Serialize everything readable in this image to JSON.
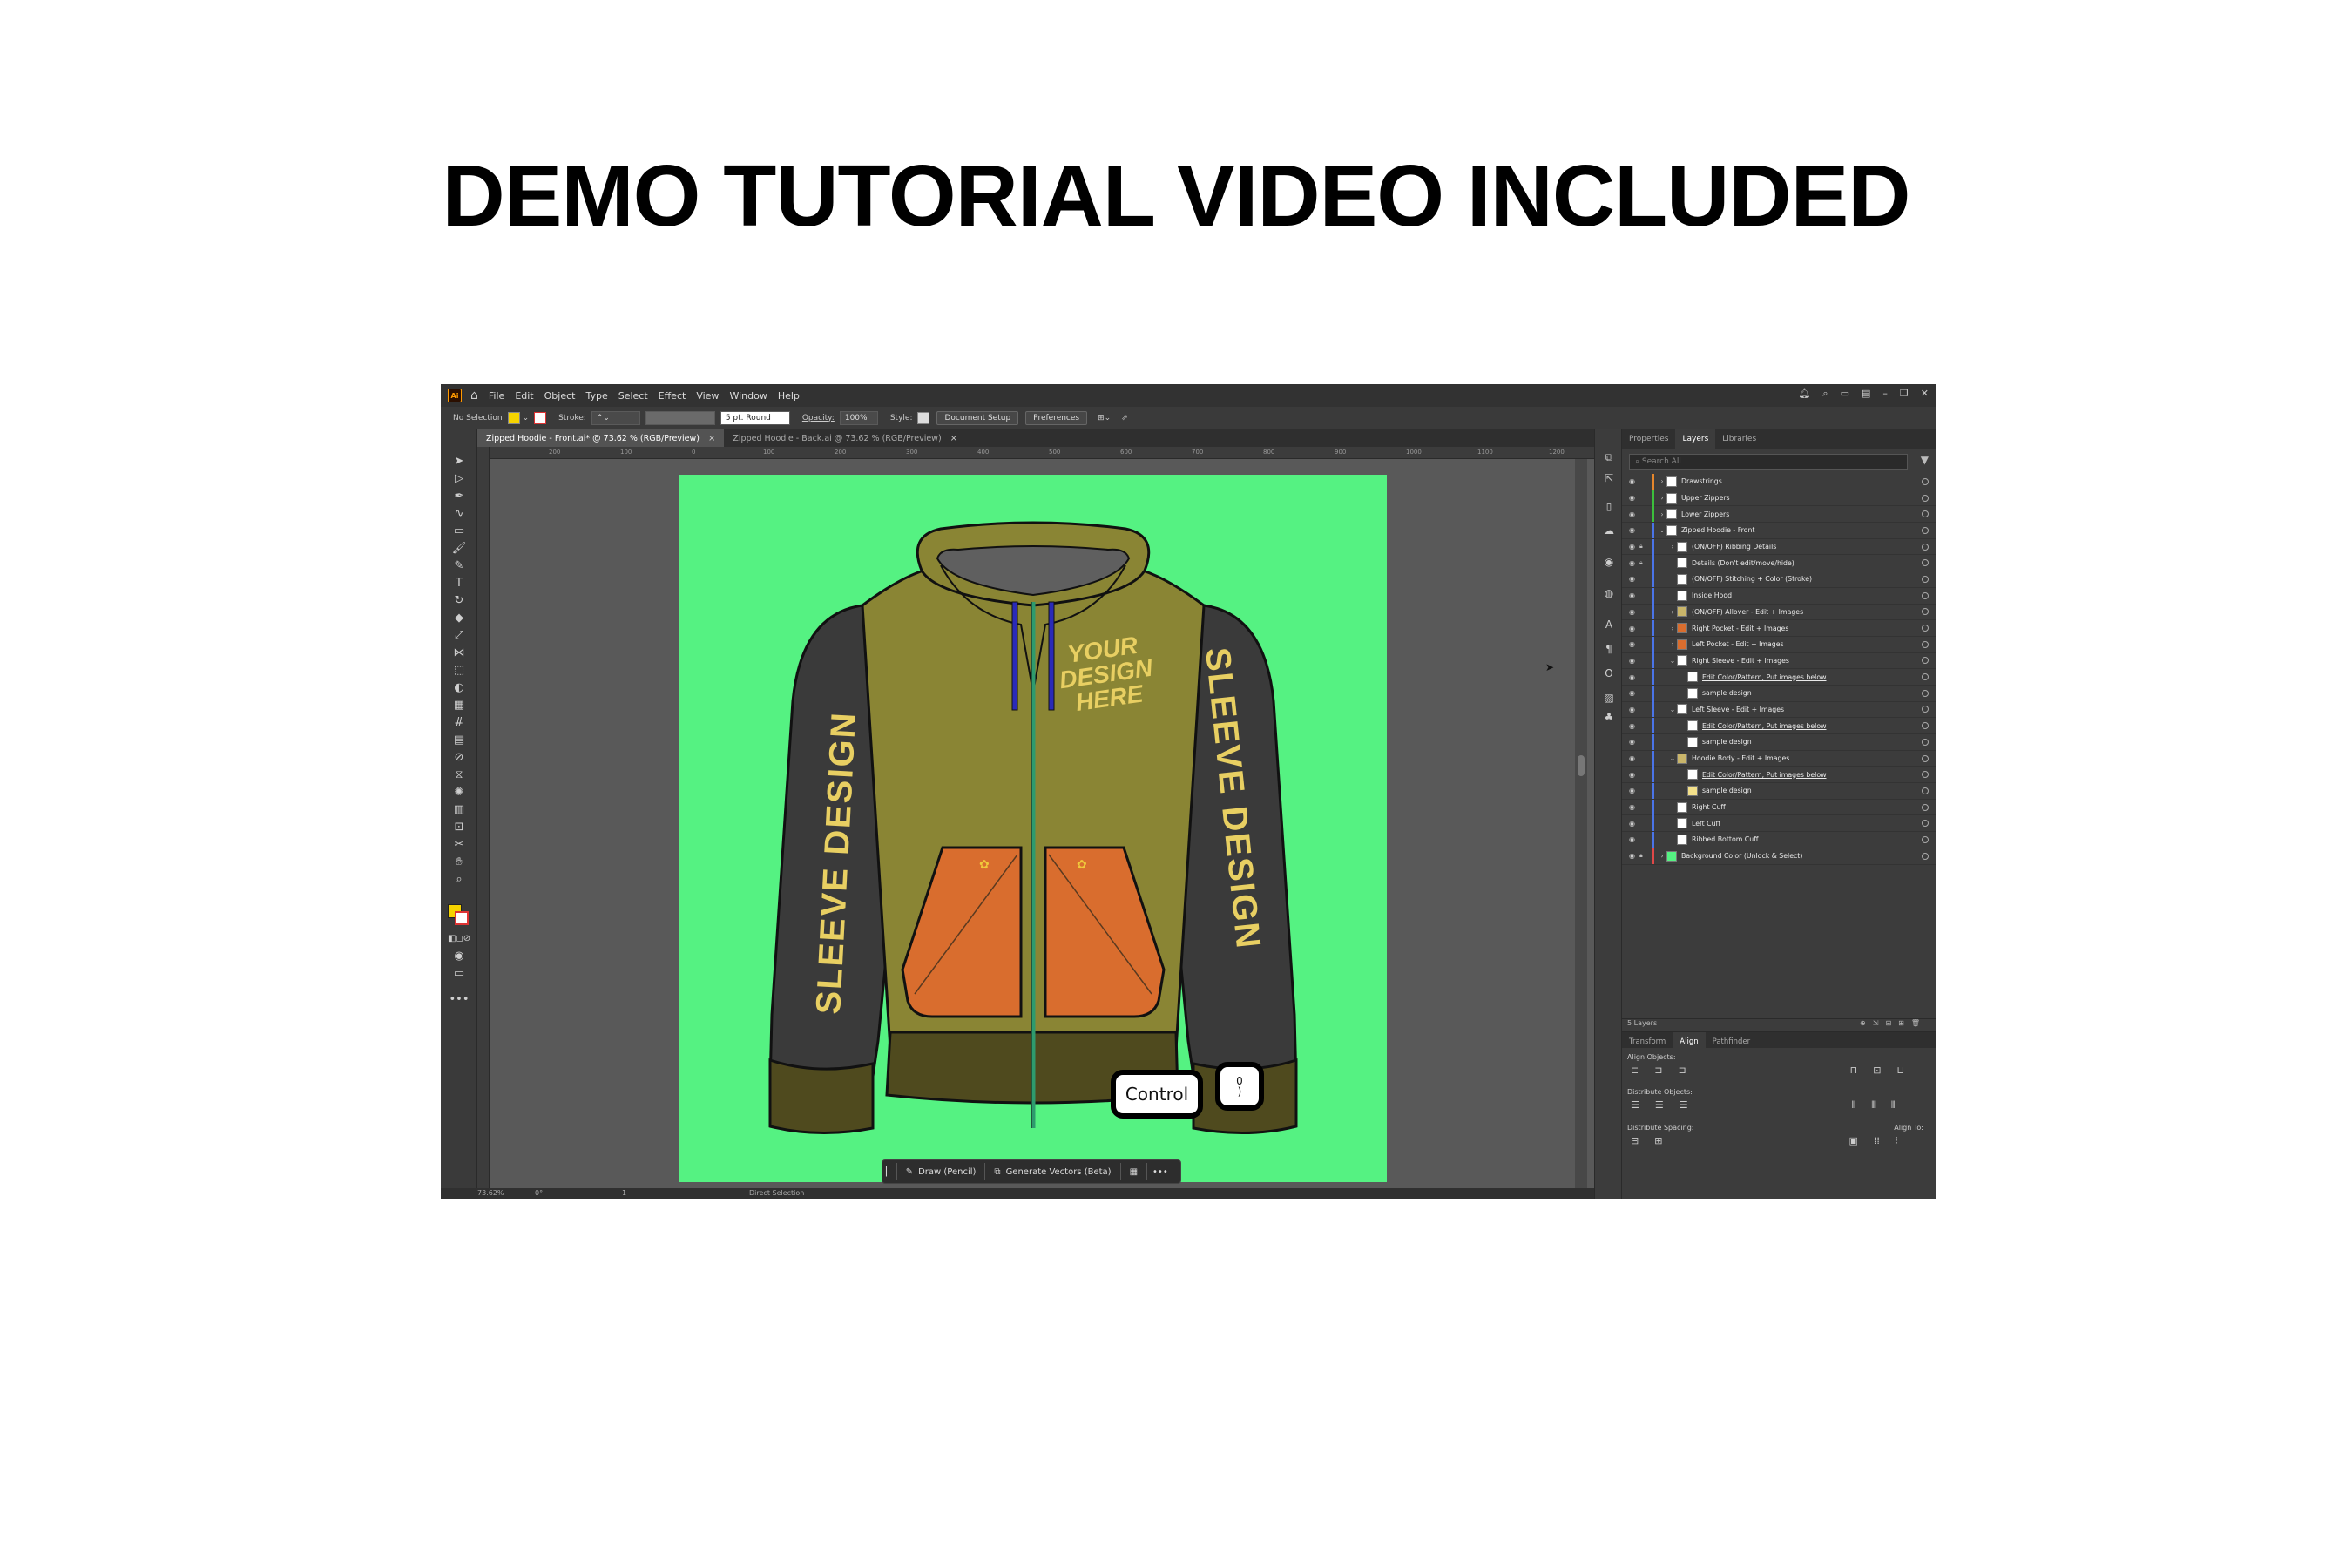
{
  "headline": "DEMO TUTORIAL VIDEO INCLUDED",
  "menu": {
    "app_logo": "Ai",
    "items": [
      "File",
      "Edit",
      "Object",
      "Type",
      "Select",
      "Effect",
      "View",
      "Window",
      "Help"
    ]
  },
  "control_bar": {
    "selection": "No Selection",
    "stroke_label": "Stroke:",
    "brush": "5 pt. Round",
    "opacity_label": "Opacity:",
    "opacity_value": "100%",
    "style_label": "Style:",
    "document_setup": "Document Setup",
    "preferences": "Preferences",
    "fill_color": "#f5d300"
  },
  "doc_tabs": [
    {
      "label": "Zipped Hoodie - Front.ai* @ 73.62 % (RGB/Preview)",
      "active": true
    },
    {
      "label": "Zipped Hoodie - Back.ai @ 73.62 % (RGB/Preview)",
      "active": false
    }
  ],
  "ruler_labels": [
    "200",
    "100",
    "0",
    "100",
    "200",
    "300",
    "400",
    "500",
    "600",
    "700",
    "800",
    "900",
    "1000",
    "1100",
    "1200"
  ],
  "artwork": {
    "chest_text": [
      "YOUR",
      "DESIGN",
      "HERE"
    ],
    "sleeve_text": "SLEEVE DESIGN",
    "artboard_color": "#55f282",
    "body_color": "#8a8534",
    "sleeve_color": "#3a3a3a",
    "pocket_color": "#d96d2e",
    "cuff_color": "#4f4a1e"
  },
  "context_bar": {
    "draw": "Draw (Pencil)",
    "generate": "Generate Vectors (Beta)",
    "more": "•••"
  },
  "overlay": {
    "control_key": "Control",
    "zero_key": "0",
    "zero_sub": ")"
  },
  "status_bar": {
    "zoom": "73.62%",
    "rotate": "0°",
    "artboard_nav": "1",
    "tool": "Direct Selection"
  },
  "right_panel": {
    "tabs": [
      "Properties",
      "Layers",
      "Libraries"
    ],
    "active_tab": "Layers",
    "search_placeholder": "Search All",
    "layers": [
      {
        "name": "Drawstrings",
        "level": 0,
        "arrow": "›",
        "color": "#e5862c",
        "thumb": "#ffffff",
        "lock": false,
        "link": false
      },
      {
        "name": "Upper Zippers",
        "level": 0,
        "arrow": "›",
        "color": "#3cbf3c",
        "thumb": "#ffffff",
        "lock": false,
        "link": false
      },
      {
        "name": "Lower Zippers",
        "level": 0,
        "arrow": "›",
        "color": "#3cbf3c",
        "thumb": "#ffffff",
        "lock": false,
        "link": false
      },
      {
        "name": "Zipped Hoodie - Front",
        "level": 0,
        "arrow": "⌄",
        "color": "#4a74e8",
        "thumb": "#ffffff",
        "lock": false,
        "link": false
      },
      {
        "name": "(ON/OFF) Ribbing Details",
        "level": 1,
        "arrow": "›",
        "color": "#4a74e8",
        "thumb": "#ffffff",
        "lock": true,
        "link": false
      },
      {
        "name": "Details (Don't edit/move/hide)",
        "level": 1,
        "arrow": "",
        "color": "#4a74e8",
        "thumb": "#ffffff",
        "lock": true,
        "link": false
      },
      {
        "name": "(ON/OFF) Stitching + Color (Stroke)",
        "level": 1,
        "arrow": "",
        "color": "#4a74e8",
        "thumb": "#ffffff",
        "lock": false,
        "link": false
      },
      {
        "name": "Inside Hood",
        "level": 1,
        "arrow": "",
        "color": "#4a74e8",
        "thumb": "#ffffff",
        "lock": false,
        "link": false
      },
      {
        "name": "(ON/OFF) Allover - Edit + Images",
        "level": 1,
        "arrow": "›",
        "color": "#4a74e8",
        "thumb": "#c9b56a",
        "lock": false,
        "link": false
      },
      {
        "name": "Right Pocket - Edit + Images",
        "level": 1,
        "arrow": "›",
        "color": "#4a74e8",
        "thumb": "#d96d2e",
        "lock": false,
        "link": false
      },
      {
        "name": "Left Pocket - Edit + Images",
        "level": 1,
        "arrow": "›",
        "color": "#4a74e8",
        "thumb": "#d96d2e",
        "lock": false,
        "link": false
      },
      {
        "name": "Right Sleeve - Edit + Images",
        "level": 1,
        "arrow": "⌄",
        "color": "#4a74e8",
        "thumb": "#ffffff",
        "lock": false,
        "link": false
      },
      {
        "name": "Edit Color/Pattern, Put images below",
        "level": 2,
        "arrow": "",
        "color": "#4a74e8",
        "thumb": "#ffffff",
        "lock": false,
        "link": true
      },
      {
        "name": "sample design",
        "level": 2,
        "arrow": "",
        "color": "#4a74e8",
        "thumb": "#ffffff",
        "lock": false,
        "link": false
      },
      {
        "name": "Left Sleeve - Edit + Images",
        "level": 1,
        "arrow": "⌄",
        "color": "#4a74e8",
        "thumb": "#ffffff",
        "lock": false,
        "link": false
      },
      {
        "name": "Edit Color/Pattern, Put images below",
        "level": 2,
        "arrow": "",
        "color": "#4a74e8",
        "thumb": "#ffffff",
        "lock": false,
        "link": true
      },
      {
        "name": "sample design",
        "level": 2,
        "arrow": "",
        "color": "#4a74e8",
        "thumb": "#ffffff",
        "lock": false,
        "link": false
      },
      {
        "name": "Hoodie Body - Edit + Images",
        "level": 1,
        "arrow": "⌄",
        "color": "#4a74e8",
        "thumb": "#c9b56a",
        "lock": false,
        "link": false
      },
      {
        "name": "Edit Color/Pattern, Put images below",
        "level": 2,
        "arrow": "",
        "color": "#4a74e8",
        "thumb": "#ffffff",
        "lock": false,
        "link": true
      },
      {
        "name": "sample design",
        "level": 2,
        "arrow": "",
        "color": "#4a74e8",
        "thumb": "#f3e08a",
        "lock": false,
        "link": false
      },
      {
        "name": "Right Cuff",
        "level": 1,
        "arrow": "",
        "color": "#4a74e8",
        "thumb": "#ffffff",
        "lock": false,
        "link": false
      },
      {
        "name": "Left Cuff",
        "level": 1,
        "arrow": "",
        "color": "#4a74e8",
        "thumb": "#ffffff",
        "lock": false,
        "link": false
      },
      {
        "name": "Ribbed Bottom Cuff",
        "level": 1,
        "arrow": "",
        "color": "#4a74e8",
        "thumb": "#ffffff",
        "lock": false,
        "link": false
      },
      {
        "name": "Background Color (Unlock & Select)",
        "level": 0,
        "arrow": "›",
        "color": "#e04848",
        "thumb": "#55f282",
        "lock": true,
        "link": false
      }
    ],
    "layers_count": "5 Layers",
    "align": {
      "tabs": [
        "Transform",
        "Align",
        "Pathfinder"
      ],
      "active_tab": "Align",
      "align_objects": "Align Objects:",
      "distribute_objects": "Distribute Objects:",
      "distribute_spacing": "Distribute Spacing:",
      "align_to": "Align To:"
    }
  }
}
